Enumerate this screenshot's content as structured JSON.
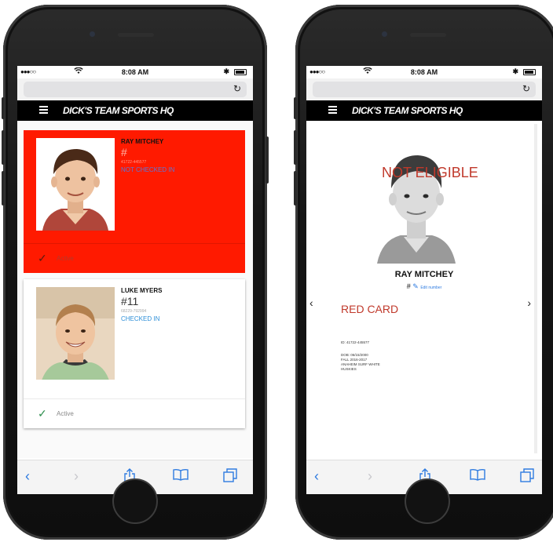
{
  "statusbar": {
    "signal": "●●●○○",
    "wifi": "wifi-icon",
    "time": "8:08 AM",
    "bluetooth": "✱"
  },
  "app": {
    "brand": "DICK'S TEAM SPORTS HQ"
  },
  "roster": {
    "players": [
      {
        "name": "RAY MITCHEY",
        "number": "#",
        "id": "41722-445577",
        "status": "NOT CHECKED IN",
        "active": "Active",
        "card_color": "#ff1a00"
      },
      {
        "name": "LUKE MYERS",
        "number": "#11",
        "id": "68229-792994",
        "status": "CHECKED IN",
        "active": "Active",
        "card_color": "#ffffff"
      }
    ]
  },
  "detail": {
    "overlay": "NOT ELIGIBLE",
    "name": "RAY MITCHEY",
    "number": "#",
    "edit_label": "Edit number",
    "card": "RED CARD",
    "id_line": "ID: 41722-445577",
    "dob": "DOB: 06/15/2000",
    "season": "FALL 2016-2017",
    "team1": "ANAHEIM SURF WHITE",
    "team2": "HUSKIES"
  },
  "toolbar": [
    "back-icon",
    "forward-icon",
    "share-icon",
    "bookmarks-icon",
    "tabs-icon"
  ],
  "colors": {
    "accent": "#2e7be0",
    "red": "#ff1a00",
    "alert_text": "#c0392b",
    "check": "#2f8f4e"
  }
}
